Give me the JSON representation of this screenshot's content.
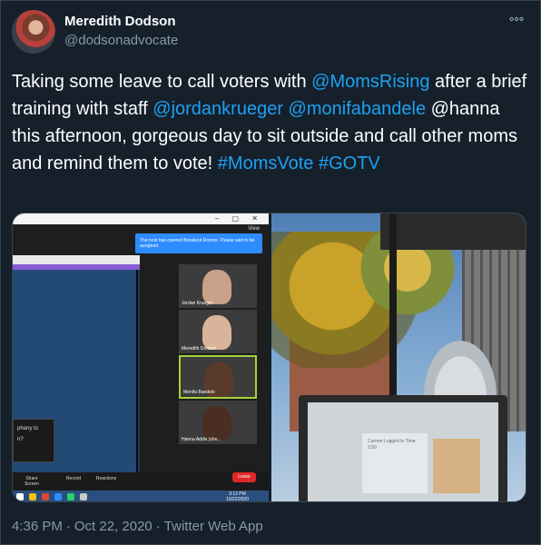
{
  "author": {
    "name": "Meredith Dodson",
    "handle": "@dodsonadvocate"
  },
  "more_icon": "more-horizontal-icon",
  "tweet": {
    "text_parts": [
      {
        "type": "text",
        "value": "Taking some leave to call voters with "
      },
      {
        "type": "mention",
        "value": "@MomsRising"
      },
      {
        "type": "text",
        "value": " after a brief training with staff "
      },
      {
        "type": "mention",
        "value": "@jordankrueger"
      },
      {
        "type": "text",
        "value": " "
      },
      {
        "type": "mention",
        "value": "@monifabandele"
      },
      {
        "type": "text",
        "value": " @hanna this afternoon, gorgeous day to sit outside and call other moms and remind them to vote! "
      },
      {
        "type": "hashtag",
        "value": "#MomsVote"
      },
      {
        "type": "text",
        "value": " "
      },
      {
        "type": "hashtag",
        "value": "#GOTV"
      }
    ]
  },
  "media": {
    "left": {
      "view_label": "View",
      "banner_text": "The host has opened Breakout Rooms. Please wait to be assigned.",
      "chat_text": "phany to",
      "chat_text2": "n?",
      "participants": [
        {
          "label": "Jordan Krueger"
        },
        {
          "label": "Meredith Dodson"
        },
        {
          "label": "Monifa Bandele"
        },
        {
          "label": "Hanna Addis (she..."
        }
      ],
      "controls": [
        "Share Screen",
        "Record",
        "Reactions"
      ],
      "leave_label": "Leave",
      "clock_time": "3:12 PM",
      "clock_date": "10/22/2020"
    },
    "right": {
      "doc_text": "Current Logged In Time: 2:50"
    }
  },
  "meta": {
    "time": "4:36 PM",
    "date": "Oct 22, 2020",
    "separator": "·",
    "source": "Twitter Web App"
  }
}
